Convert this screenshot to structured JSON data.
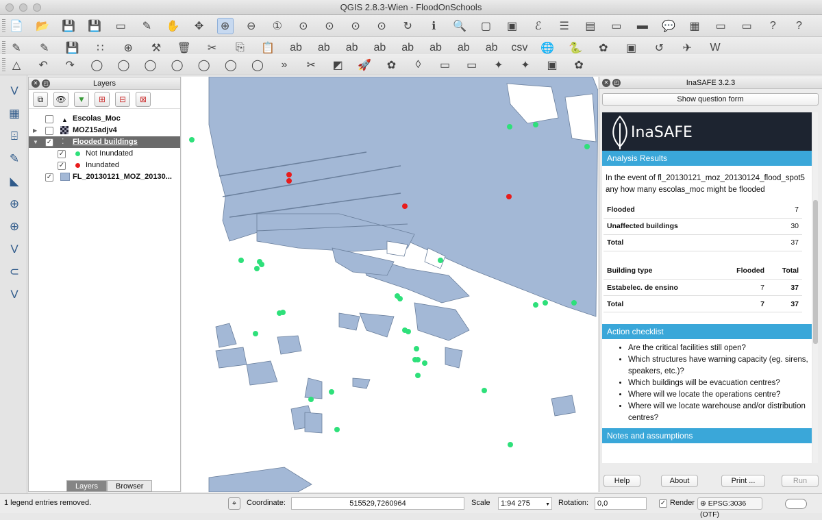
{
  "window": {
    "title": "QGIS 2.8.3-Wien - FloodOnSchools"
  },
  "layers_panel": {
    "title": "Layers",
    "tabs": [
      "Layers",
      "Browser"
    ],
    "items": [
      {
        "label": "Escolas_Moc",
        "checked": false
      },
      {
        "label": "MOZ15adjv4",
        "checked": false
      },
      {
        "label": "Flooded buildings",
        "checked": true
      },
      {
        "label": "Not Inundated",
        "checked": true,
        "color": "#2ee07a"
      },
      {
        "label": "Inundated",
        "checked": true,
        "color": "#e81c1c"
      },
      {
        "label": "FL_20130121_MOZ_20130...",
        "checked": true,
        "color": "#a3b8d6"
      }
    ]
  },
  "inasafe": {
    "title": "InaSAFE 3.2.3",
    "show_question_form": "Show question form",
    "logo_text": "InaSAFE",
    "analysis_header": "Analysis Results",
    "question": "In the event of fl_20130121_moz_20130124_flood_spot5 any how many escolas_moc might be flooded",
    "summary": [
      {
        "label": "Flooded",
        "value": "7"
      },
      {
        "label": "Unaffected buildings",
        "value": "30"
      },
      {
        "label": "Total",
        "value": "37"
      }
    ],
    "breakdown": {
      "headers": [
        "Building type",
        "Flooded",
        "Total"
      ],
      "rows": [
        [
          "Estabelec. de ensino",
          "7",
          "37"
        ],
        [
          "Total",
          "7",
          "37"
        ]
      ]
    },
    "checklist_header": "Action checklist",
    "checklist": [
      "Are the critical facilities still open?",
      "Which structures have warning capacity (eg. sirens, speakers, etc.)?",
      "Which buildings will be evacuation centres?",
      "Where will we locate the operations centre?",
      "Where will we locate warehouse and/or distribution centres?"
    ],
    "notes_header": "Notes and assumptions",
    "buttons": {
      "help": "Help",
      "about": "About",
      "print": "Print ...",
      "run": "Run"
    }
  },
  "status": {
    "message": "1 legend entries removed.",
    "coordinate_label": "Coordinate:",
    "coordinate": "515529,7260964",
    "scale_label": "Scale",
    "scale": "1:94 275",
    "rotation_label": "Rotation:",
    "rotation": "0,0",
    "render_label": "Render",
    "crs": "EPSG:3036 (OTF)"
  },
  "colors": {
    "flood": "#a3b8d6",
    "not_inundated": "#2ee07a",
    "inundated": "#e81c1c",
    "accent": "#3aa7d9"
  }
}
